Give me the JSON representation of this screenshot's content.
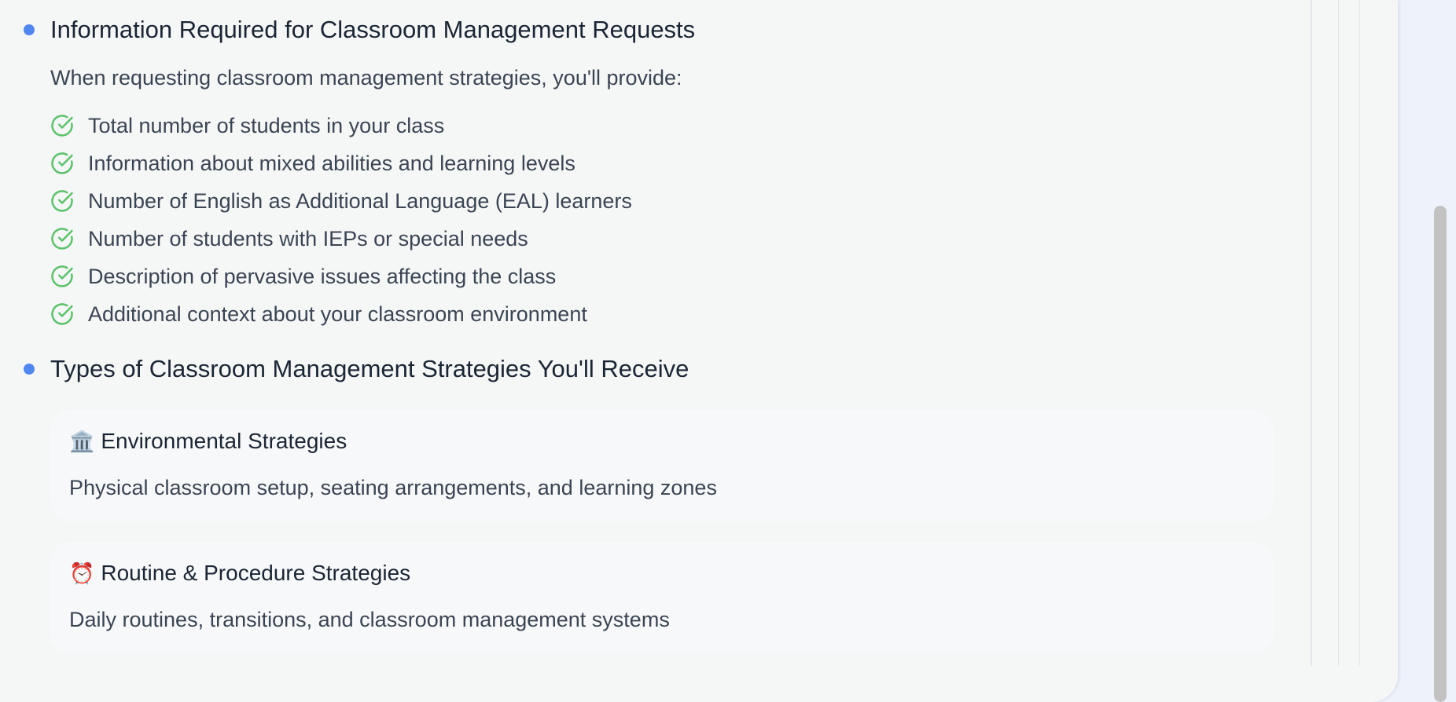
{
  "section_requirements": {
    "heading": "Information Required for Classroom Management Requests",
    "intro": "When requesting classroom management strategies, you'll provide:",
    "items": [
      "Total number of students in your class",
      "Information about mixed abilities and learning levels",
      "Number of English as Additional Language (EAL) learners",
      "Number of students with IEPs or special needs",
      "Description of pervasive issues affecting the class",
      "Additional context about your classroom environment"
    ]
  },
  "section_strategies": {
    "heading": "Types of Classroom Management Strategies You'll Receive",
    "cards": [
      {
        "emoji": "🏛️",
        "title": "Environmental Strategies",
        "description": "Physical classroom setup, seating arrangements, and learning zones"
      },
      {
        "emoji": "⏰",
        "title": "Routine & Procedure Strategies",
        "description": "Daily routines, transitions, and classroom management systems"
      }
    ]
  },
  "colors": {
    "accent_blue": "#4f86f0",
    "check_green": "#5cc26a",
    "panel_bg": "#f5f7f7",
    "page_bg": "#eef2fb"
  },
  "icons": {
    "check": "check-circle-icon",
    "bullet": "bullet-dot-icon"
  }
}
